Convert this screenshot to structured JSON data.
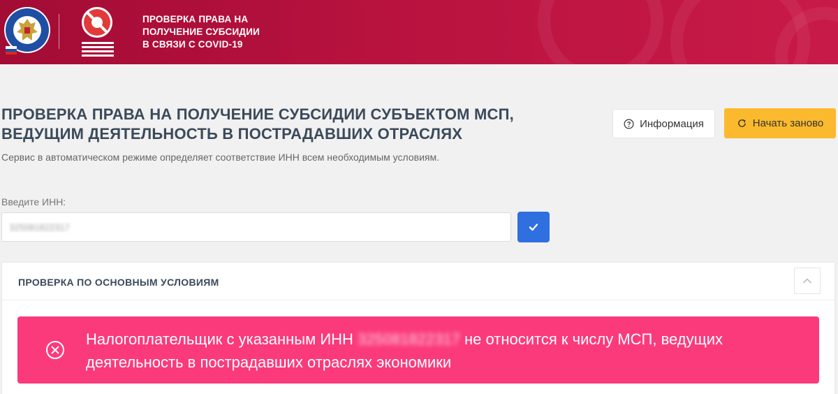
{
  "header": {
    "title_lines": [
      "ПРОВЕРКА ПРАВА НА",
      "ПОЛУЧЕНИЕ СУБСИДИИ",
      "В СВЯЗИ С COVID-19"
    ],
    "fns_logo_text": "ФЕДЕРАЛЬНАЯ НАЛОГОВАЯ СЛУЖБА",
    "colors": {
      "background": "#b8123f",
      "text": "#ffffff"
    }
  },
  "page": {
    "title": "ПРОВЕРКА ПРАВА НА ПОЛУЧЕНИЕ СУБСИДИИ СУБЪЕКТОМ МСП, ВЕДУЩИМ ДЕЯТЕЛЬНОСТЬ В ПОСТРАДАВШИХ ОТРАСЛЯХ",
    "subtitle": "Сервис в автоматическом режиме определяет соответствие ИНН всем необходимым условиям."
  },
  "actions": {
    "info_label": "Информация",
    "info_icon": "question-circle-icon",
    "restart_label": "Начать заново",
    "restart_icon": "refresh-icon",
    "restart_color": "#fbb92d"
  },
  "form": {
    "inn_label": "Введите ИНН:",
    "inn_value": "325081822317",
    "submit_icon": "check-icon",
    "submit_color": "#2f6fe0"
  },
  "check_section": {
    "title": "ПРОВЕРКА ПО ОСНОВНЫМ УСЛОВИЯМ",
    "collapse_icon": "chevron-up-icon"
  },
  "alert": {
    "prefix": "Налогоплательщик с указанным ИНН",
    "inn": "325081822317",
    "suffix": "не относится к числу МСП, ведущих деятельность в пострадавших отраслях экономики",
    "icon": "close-circle-icon",
    "color": "#fb3a7b"
  }
}
